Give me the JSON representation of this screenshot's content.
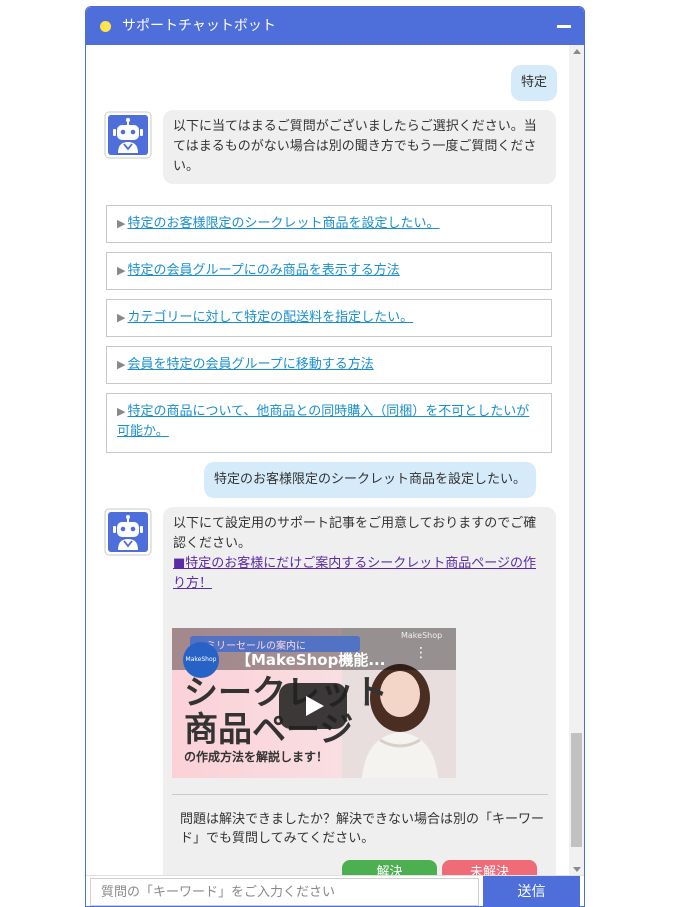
{
  "header": {
    "title": "サポートチャットボット"
  },
  "messages": {
    "user_1": "特定",
    "bot_1": "以下に当てはまるご質問がございましたらご選択ください。当てはまるものがない場合は別の聞き方でもう一度ご質問ください。",
    "options": [
      "特定のお客様限定のシークレット商品を設定したい。",
      "特定の会員グループにのみ商品を表示する方法",
      "カテゴリーに対して特定の配送料を指定したい。",
      "会員を特定の会員グループに移動する方法",
      "特定の商品について、他商品との同時購入（同梱）を不可としたいが可能か。"
    ],
    "option_arrow": "▶",
    "user_2": "特定のお客様限定のシークレット商品を設定したい。",
    "bot_2_text": "以下にて設定用のサポート記事をご用意しておりますのでご確認ください。",
    "bot_2_link": "■特定のお客様にだけご案内するシークレット商品ページの作り方！",
    "video": {
      "title": "【MakeShop機能...",
      "banner": "ァミリーセールの案内に",
      "big_line_1": "シークレット",
      "big_line_2": "商品ページ",
      "sub": "の作成方法を解説します！",
      "logo": "MakeShop",
      "watermark": "MakeShop"
    },
    "feedback_text": "問題は解決できましたか？解決できない場合は別の「キーワード」でも質問してみてください。",
    "resolved_label": "解決",
    "unresolved_label": "未解決"
  },
  "input": {
    "placeholder": "質問の「キーワード」をご入力ください",
    "send_label": "送信"
  },
  "colors": {
    "header": "#4e6fda",
    "user_bubble": "#d6ebf9",
    "bot_bubble": "#efefef",
    "link": "#1a8fd0",
    "article_link": "#5c2aa5",
    "resolved": "#4caf50",
    "unresolved": "#ef6b78"
  }
}
